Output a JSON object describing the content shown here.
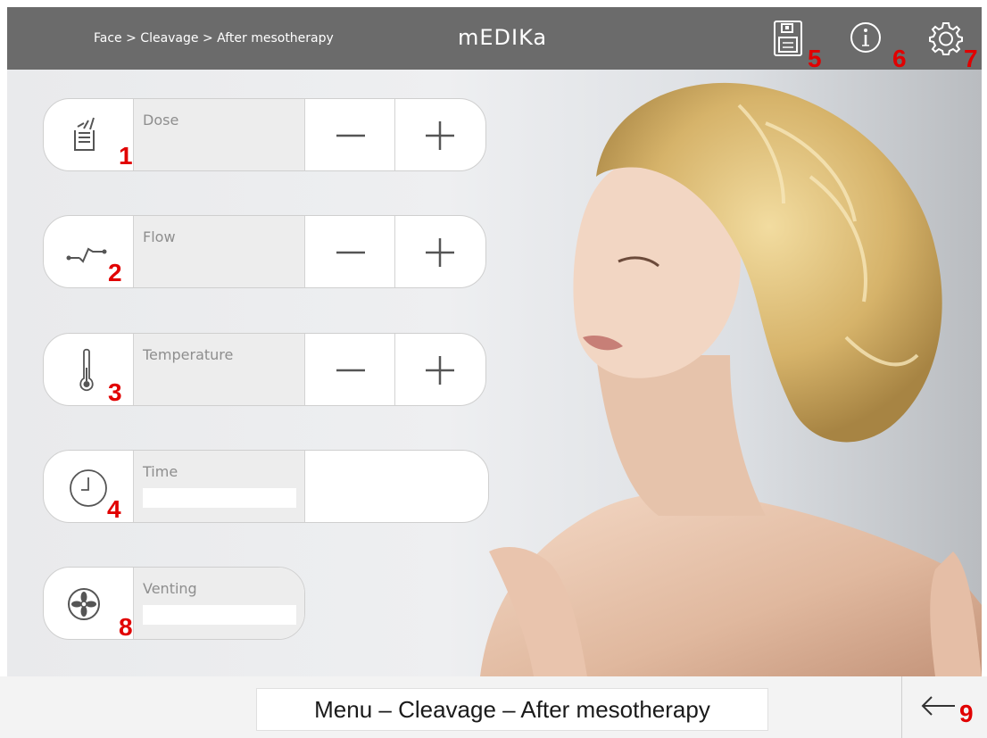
{
  "header": {
    "breadcrumb": "Face > Cleavage > After mesotherapy",
    "logo": "mEDIKa",
    "icons": [
      {
        "name": "save-icon",
        "marker": "5"
      },
      {
        "name": "info-icon",
        "marker": "6"
      },
      {
        "name": "settings-icon",
        "marker": "7"
      }
    ]
  },
  "controls": [
    {
      "label": "Dose",
      "icon": "dose-icon",
      "marker": "1",
      "minus": "minus-icon",
      "plus": "plus-icon"
    },
    {
      "label": "Flow",
      "icon": "flow-icon",
      "marker": "2",
      "minus": "minus-icon",
      "plus": "plus-icon"
    },
    {
      "label": "Temperature",
      "icon": "thermometer-icon",
      "marker": "3",
      "minus": "minus-icon",
      "plus": "plus-icon"
    },
    {
      "label": "Time",
      "icon": "clock-icon",
      "marker": "4",
      "value": ""
    },
    {
      "label": "Venting",
      "icon": "fan-icon",
      "marker": "8",
      "value": ""
    }
  ],
  "footer": {
    "menu": "Menu – Cleavage – After mesotherapy",
    "back_icon": "arrow-left-icon",
    "back_marker": "9"
  },
  "colors": {
    "header_bg": "#6b6b6b",
    "marker": "#e10000",
    "panel_bg": "#ededed"
  }
}
